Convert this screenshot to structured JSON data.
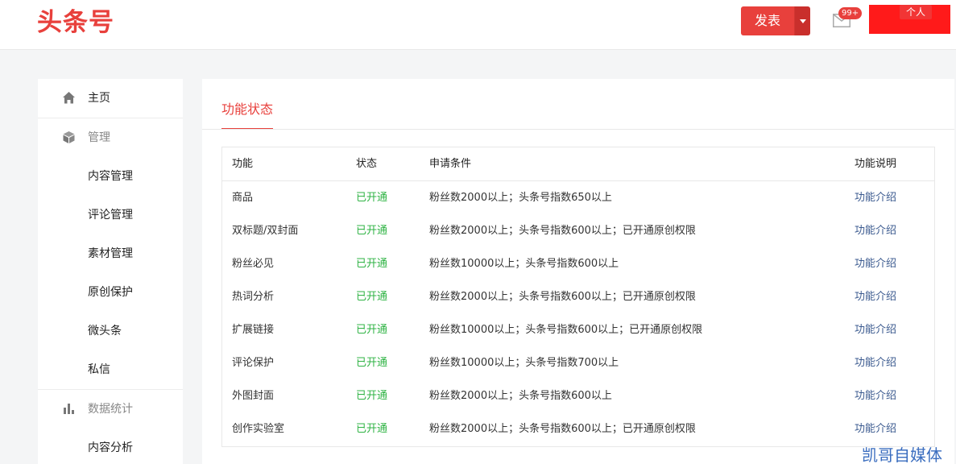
{
  "header": {
    "logo": "头条号",
    "publish_label": "发表",
    "mail_badge": "99+",
    "user_tag": "个人"
  },
  "sidebar": {
    "items": [
      {
        "label": "主页",
        "icon": "home-icon",
        "group": false
      },
      {
        "label": "管理",
        "icon": "cube-icon",
        "group": true
      },
      {
        "label": "内容管理"
      },
      {
        "label": "评论管理"
      },
      {
        "label": "素材管理"
      },
      {
        "label": "原创保护"
      },
      {
        "label": "微头条"
      },
      {
        "label": "私信"
      },
      {
        "label": "数据统计",
        "icon": "bar-chart-icon",
        "group": true
      },
      {
        "label": "内容分析"
      }
    ]
  },
  "main": {
    "tab": "功能状态",
    "columns": [
      "功能",
      "状态",
      "申请条件",
      "功能说明"
    ],
    "rows": [
      {
        "feature": "商品",
        "status": "已开通",
        "condition": "粉丝数2000以上；头条号指数650以上",
        "desc": "功能介绍"
      },
      {
        "feature": "双标题/双封面",
        "status": "已开通",
        "condition": "粉丝数2000以上；头条号指数600以上；已开通原创权限",
        "desc": "功能介绍"
      },
      {
        "feature": "粉丝必见",
        "status": "已开通",
        "condition": "粉丝数10000以上；头条号指数600以上",
        "desc": "功能介绍"
      },
      {
        "feature": "热词分析",
        "status": "已开通",
        "condition": "粉丝数2000以上；头条号指数600以上；已开通原创权限",
        "desc": "功能介绍"
      },
      {
        "feature": "扩展链接",
        "status": "已开通",
        "condition": "粉丝数10000以上；头条号指数600以上；已开通原创权限",
        "desc": "功能介绍"
      },
      {
        "feature": "评论保护",
        "status": "已开通",
        "condition": "粉丝数10000以上；头条号指数700以上",
        "desc": "功能介绍"
      },
      {
        "feature": "外图封面",
        "status": "已开通",
        "condition": "粉丝数2000以上；头条号指数600以上",
        "desc": "功能介绍"
      },
      {
        "feature": "创作实验室",
        "status": "已开通",
        "condition": "粉丝数2000以上；头条号指数600以上；已开通原创权限",
        "desc": "功能介绍"
      }
    ]
  },
  "watermark": "凯哥自媒体",
  "colors": {
    "brand": "#e8403c",
    "status_green": "#2fb344",
    "link_blue": "#3b5a8f"
  }
}
